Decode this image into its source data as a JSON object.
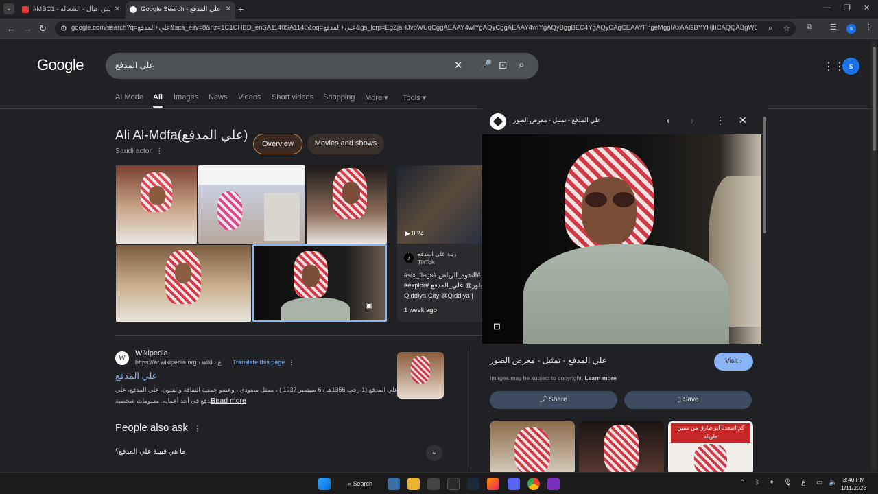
{
  "browser": {
    "tabs": [
      {
        "title": "#MBC1 - طيش عيال - الشعالة ·"
      },
      {
        "title": "Google Search - علي المدفع"
      }
    ],
    "url": "google.com/search?q=علي+المدفع&sca_esv=8&rlz=1C1CHBD_enSA1140SA1140&oq=علي+المدفع&gs_lcrp=EgZjaHJvbWUqCggAEAAY4wIYgAQyCggAEAAY4wIYgAQyBggBEC4YgAQyCAgCEAAYFhgeMggIAxAAGBYYHjIICAQQABgWGB4yCAgFEAAYFhgeMgg"
  },
  "google": {
    "logo": "Google",
    "query": "علي المدفع",
    "avatar_letter": "s",
    "nav": [
      "AI Mode",
      "All",
      "Images",
      "News",
      "Videos",
      "Short videos",
      "Shopping",
      "More",
      "Tools"
    ]
  },
  "entity": {
    "title": "Ali Al-Mdfa(علي المدفع)",
    "subtitle": "Saudi actor",
    "chips": [
      "Overview",
      "Movies and shows"
    ]
  },
  "video": {
    "duration": "0:24",
    "source_name": "زينة علي المدفع",
    "source_platform": "TikTok",
    "lines": [
      "#six_flags# الندوه_الرياض#",
      "#explor# اكسبلور@ علي_المدفع#",
      "Qiddiya City @Qiddiya |"
    ],
    "age": "1 week ago"
  },
  "wiki": {
    "name": "Wikipedia",
    "url": "https://ar.wikipedia.org › wiki › ع",
    "translate": "Translate this page",
    "title": "علي المدفع",
    "snippet_1": "علي المدفع (1 رجب 1356هـ / 6 سبتمبر 1937 ) ، ممثل سعودي ، وعضو جمعية الثقافة والفنون. علي المدفع، علي",
    "snippet_2": "المدفع في أحد أعماله. معلومات شخصية.",
    "read_more": "Read more"
  },
  "paa": {
    "title": "People also ask",
    "q1": "ما هي قبيلة علي المدفع؟"
  },
  "panel": {
    "source_title": "علي المدفع - تمثيل - معرض الصور",
    "caption": "علي المدفع - تمثيل - معرض الصور",
    "visit": "Visit",
    "copyright": "Images may be subject to copyright.",
    "learn_more": "Learn more",
    "share": "Share",
    "save": "Save",
    "related_text": "كم اسعدنا ابو طارق من سنين طويلة"
  },
  "taskbar": {
    "search": "Search",
    "time": "3:40 PM",
    "date": "1/11/2026",
    "lang": "ع"
  },
  "colors": {
    "accent": "#8ab4f8",
    "bg": "#202124",
    "chip_border": "#c58a5c"
  }
}
